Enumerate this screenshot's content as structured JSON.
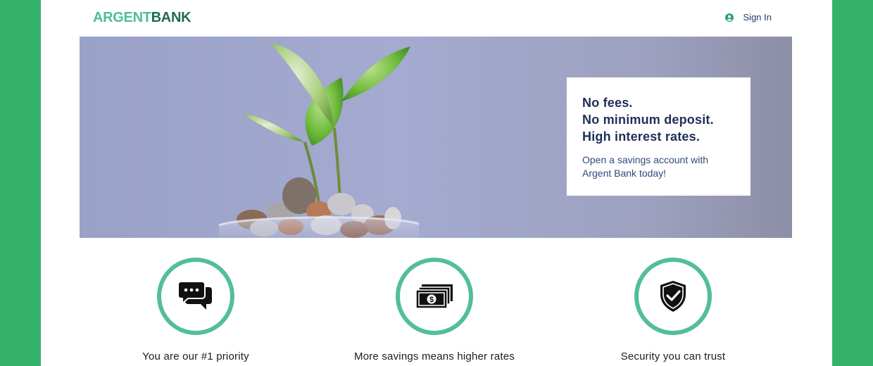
{
  "header": {
    "logo_part1": "ARGENT",
    "logo_part2": "BANK",
    "signin_label": "Sign In"
  },
  "hero": {
    "lines": [
      "No fees.",
      "No minimum deposit.",
      "High interest rates."
    ],
    "subtext": "Open a savings account with Argent Bank today!"
  },
  "features": [
    {
      "icon": "chat-bubbles-icon",
      "label": "You are our #1 priority"
    },
    {
      "icon": "money-bill-icon",
      "label": "More savings means higher rates"
    },
    {
      "icon": "shield-check-icon",
      "label": "Security you can trust"
    }
  ],
  "colors": {
    "background": "#34b26a",
    "accent": "#52bf94",
    "logo_light": "#4dbf92",
    "logo_dark": "#1f6b4f",
    "navy": "#1f2e5a"
  }
}
